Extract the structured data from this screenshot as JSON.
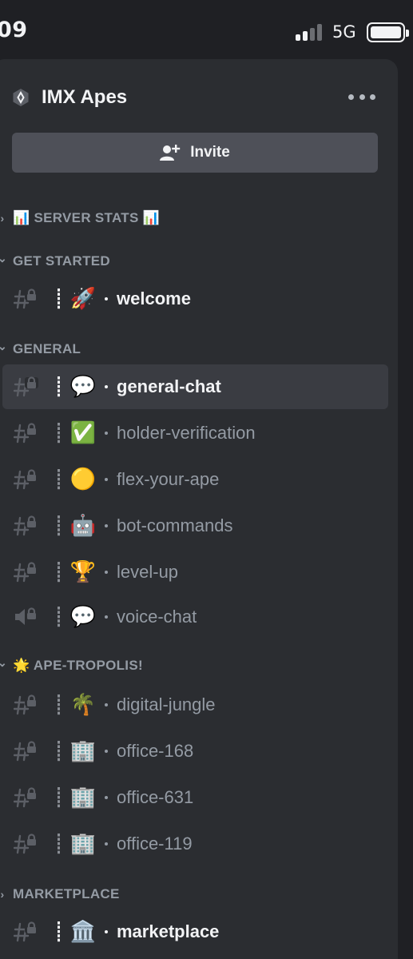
{
  "status_bar": {
    "time": "09",
    "network": "5G"
  },
  "server": {
    "name": "IMX Apes",
    "invite_label": "Invite",
    "more_icon": "more-horizontal-icon"
  },
  "colors": {
    "panel_bg": "#2b2d31",
    "active_row_bg": "#3a3c42",
    "muted_text": "#949ba4",
    "bright_text": "#f2f3f5"
  },
  "categories": [
    {
      "label": "📊 SERVER STATS 📊",
      "collapsed": true
    },
    {
      "label": "GET STARTED",
      "collapsed": false
    },
    {
      "label": "GENERAL",
      "collapsed": false
    },
    {
      "label": "🌟 APE-TROPOLIS!",
      "collapsed": false
    },
    {
      "label": "MARKETPLACE",
      "collapsed": true
    }
  ],
  "channels": [
    {
      "emoji": "🚀",
      "name": "welcome",
      "type": "text-locked",
      "unread": true,
      "active": false
    },
    {
      "emoji": "💬",
      "name": "general-chat",
      "type": "text-locked",
      "unread": true,
      "active": true
    },
    {
      "emoji": "✅",
      "name": "holder-verification",
      "type": "text-locked",
      "unread": false,
      "active": false
    },
    {
      "emoji": "🟡",
      "name": "flex-your-ape",
      "type": "text-locked",
      "unread": false,
      "active": false
    },
    {
      "emoji": "🤖",
      "name": "bot-commands",
      "type": "text-locked",
      "unread": false,
      "active": false
    },
    {
      "emoji": "🏆",
      "name": "level-up",
      "type": "text-locked",
      "unread": false,
      "active": false
    },
    {
      "emoji": "💬",
      "name": "voice-chat",
      "type": "voice-locked",
      "unread": false,
      "active": false
    },
    {
      "emoji": "🌴",
      "name": "digital-jungle",
      "type": "text-locked",
      "unread": false,
      "active": false
    },
    {
      "emoji": "🏢",
      "name": "office-168",
      "type": "text-locked",
      "unread": false,
      "active": false
    },
    {
      "emoji": "🏢",
      "name": "office-631",
      "type": "text-locked",
      "unread": false,
      "active": false
    },
    {
      "emoji": "🏢",
      "name": "office-119",
      "type": "text-locked",
      "unread": false,
      "active": false
    },
    {
      "emoji": "🏛️",
      "name": "marketplace",
      "type": "text-locked",
      "unread": true,
      "active": false
    }
  ]
}
